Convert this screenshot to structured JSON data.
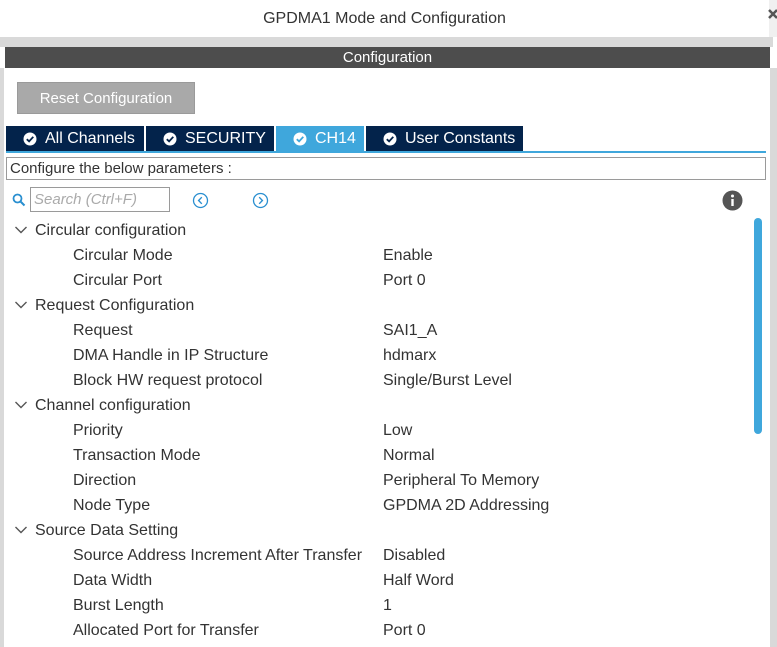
{
  "window": {
    "title": "GPDMA1 Mode and Configuration"
  },
  "panel": {
    "header": "Configuration"
  },
  "toolbar": {
    "reset_label": "Reset Configuration"
  },
  "tabs": [
    {
      "label": "All Channels",
      "active": false
    },
    {
      "label": "SECURITY",
      "active": false
    },
    {
      "label": "CH14",
      "active": true
    },
    {
      "label": "User Constants",
      "active": false
    }
  ],
  "params_label": "Configure the below parameters :",
  "search": {
    "placeholder": "Search (Ctrl+F)"
  },
  "icons": {
    "search": "search-icon",
    "prev": "circle-chevron-left-icon",
    "next": "circle-chevron-right-icon",
    "info": "info-icon",
    "check": "check-circle-icon",
    "collapse": "chevron-down-icon"
  },
  "groups": [
    {
      "title": "Circular configuration",
      "params": [
        {
          "name": "Circular Mode",
          "value": "Enable"
        },
        {
          "name": "Circular Port",
          "value": "Port 0"
        }
      ]
    },
    {
      "title": "Request Configuration",
      "params": [
        {
          "name": "Request",
          "value": "SAI1_A"
        },
        {
          "name": "DMA Handle in IP Structure",
          "value": "hdmarx"
        },
        {
          "name": "Block HW request protocol",
          "value": "Single/Burst Level"
        }
      ]
    },
    {
      "title": "Channel configuration",
      "params": [
        {
          "name": "Priority",
          "value": "Low"
        },
        {
          "name": "Transaction Mode",
          "value": "Normal"
        },
        {
          "name": "Direction",
          "value": "Peripheral To Memory"
        },
        {
          "name": "Node Type",
          "value": "GPDMA 2D Addressing"
        }
      ]
    },
    {
      "title": "Source Data Setting",
      "params": [
        {
          "name": "Source Address Increment After Transfer",
          "value": "Disabled"
        },
        {
          "name": "Data Width",
          "value": "Half Word"
        },
        {
          "name": "Burst Length",
          "value": "1"
        },
        {
          "name": "Allocated Port for Transfer",
          "value": "Port 0"
        }
      ]
    }
  ],
  "colors": {
    "tab_bg": "#03234b",
    "tab_active": "#3fa7dc",
    "header_bg": "#4d4d4d",
    "button_bg": "#a9a9a9",
    "scroll_thumb": "#3fa7dc"
  }
}
